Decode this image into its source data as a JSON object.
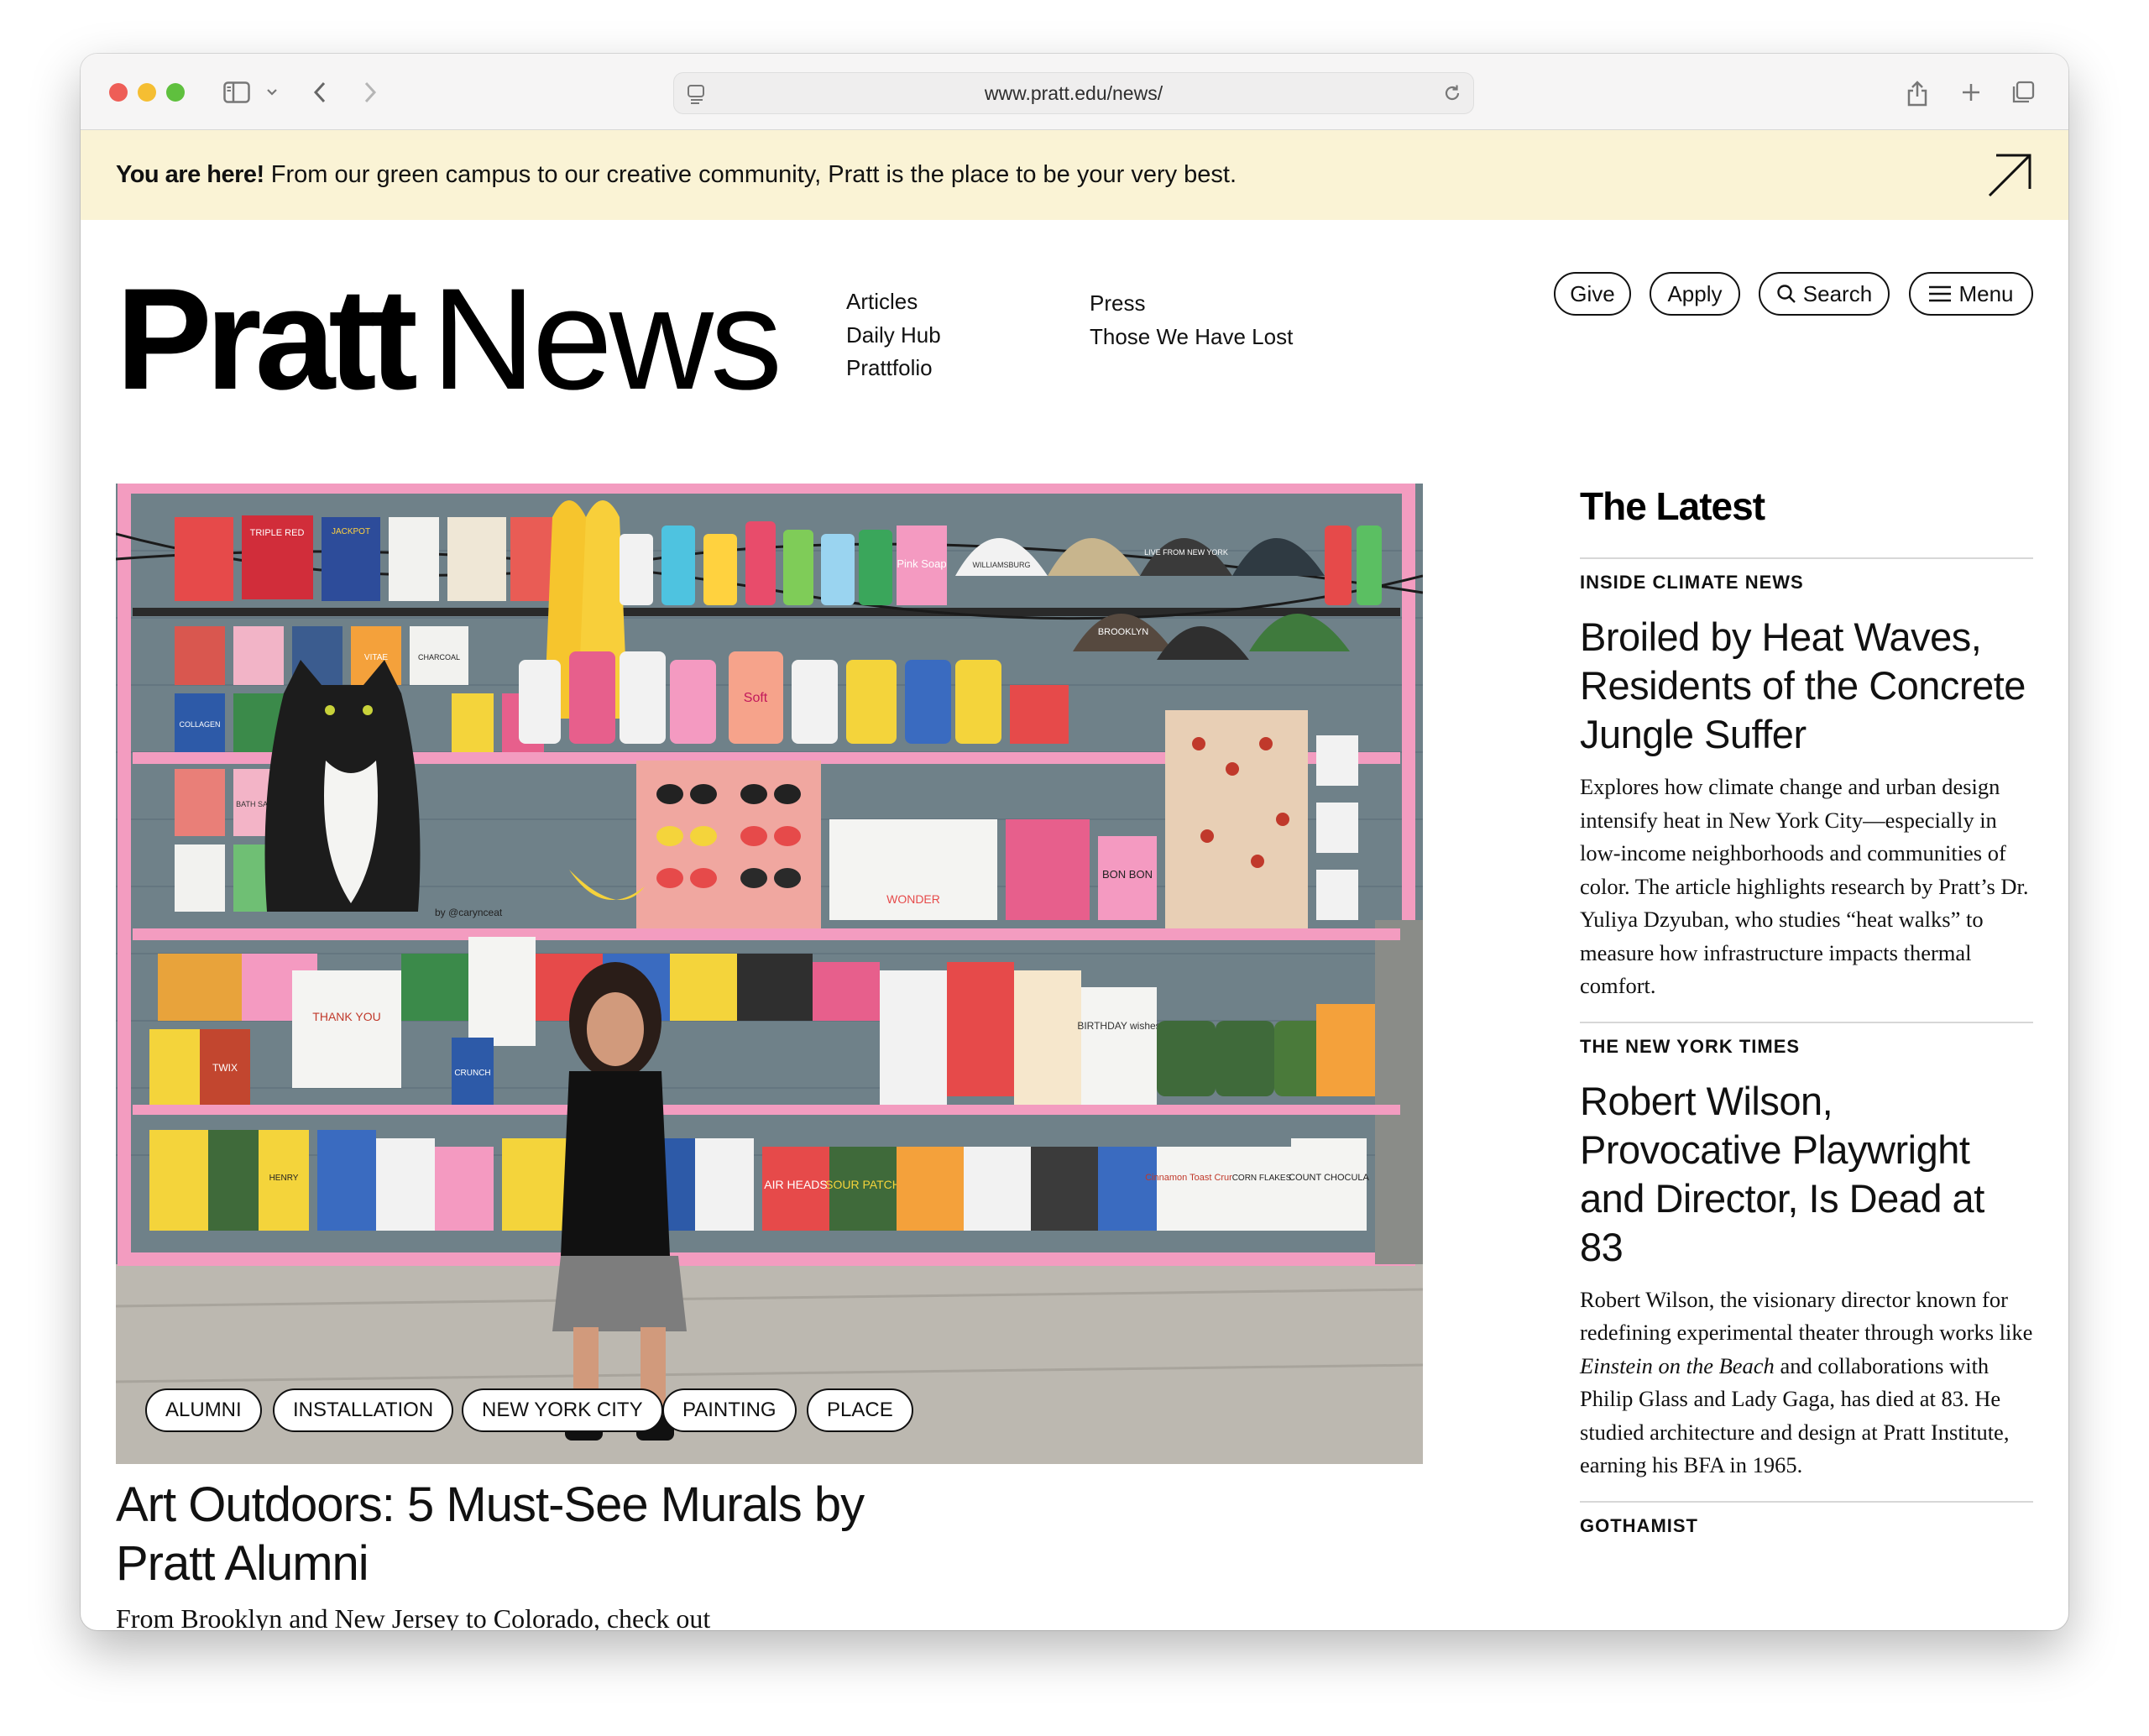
{
  "browser": {
    "url": "www.pratt.edu/news/"
  },
  "announcement": {
    "bold": "You are here!",
    "text": " From our green campus to our creative community, Pratt is the place to be your very best."
  },
  "header": {
    "logo_bold": "Pratt",
    "logo_light": "News",
    "nav_col1": [
      "Articles",
      "Daily Hub",
      "Prattfolio"
    ],
    "nav_col2": [
      "Press",
      "Those We Have Lost"
    ],
    "buttons": {
      "give": "Give",
      "apply": "Apply",
      "search": "Search",
      "menu": "Menu"
    }
  },
  "hero": {
    "tags": [
      "ALUMNI",
      "INSTALLATION",
      "NEW YORK CITY",
      "PAINTING",
      "PLACE"
    ],
    "title": "Art Outdoors: 5 Must-See Murals by Pratt Alumni",
    "dek": "From Brooklyn and New Jersey to Colorado, check out",
    "mural_labels": {
      "triple_red": "TRIPLE RED",
      "jackpot": "JACKPOT",
      "pink_soap": "Pink Soap",
      "williamsburg": "WILLIAMSBURG",
      "brooklyn": "BROOKLYN",
      "live_from_ny": "LIVE FROM NEW YORK",
      "soft": "Soft",
      "thank_you": "THANK YOU",
      "twix": "TWIX",
      "crunch": "CRUNCH",
      "air_heads": "AIR HEADS",
      "sour_patch": "SOUR PATCH",
      "wonder": "WONDER",
      "bon_bon": "BON BON",
      "birthday_wishes": "BIRTHDAY wishes",
      "count_chocula": "COUNT CHOCULA",
      "corn_flakes": "CORN FLAKES",
      "cinnamon_crunch": "Cinnamon Toast Crunch",
      "henry": "HENRY",
      "collagen": "COLLAGEN",
      "bath_salts": "BATH SALTS",
      "charcoal": "CHARCOAL",
      "vitae": "VITAE",
      "signature": "by @carynceat"
    }
  },
  "latest": {
    "heading": "The Latest",
    "items": [
      {
        "source": "INSIDE CLIMATE NEWS",
        "title": "Broiled by Heat Waves, Residents of the Concrete Jungle Suffer",
        "body": "Explores how climate change and urban design intensify heat in New York City—especially in low-income neighborhoods and communities of color. The article highlights research by Pratt’s Dr. Yuliya Dzyuban, who studies “heat walks” to measure how infrastructure impacts thermal comfort."
      },
      {
        "source": "THE NEW YORK TIMES",
        "title": "Robert Wilson, Provocative Playwright and Director, Is Dead at 83",
        "body_before": "Robert Wilson, the visionary director known for redefining experimental theater through works like ",
        "body_italic": "Einstein on the Beach",
        "body_after": " and collaborations with Philip Glass and Lady Gaga, has died at 83. He studied architecture and design at Pratt Institute, earning his BFA in 1965."
      },
      {
        "source": "GOTHAMIST"
      }
    ]
  },
  "colors": {
    "announcement_bg": "#faf3d5",
    "mural_wall": "#6e8088",
    "mural_pink": "#f39cc0",
    "sidewalk": "#bdbab3"
  }
}
